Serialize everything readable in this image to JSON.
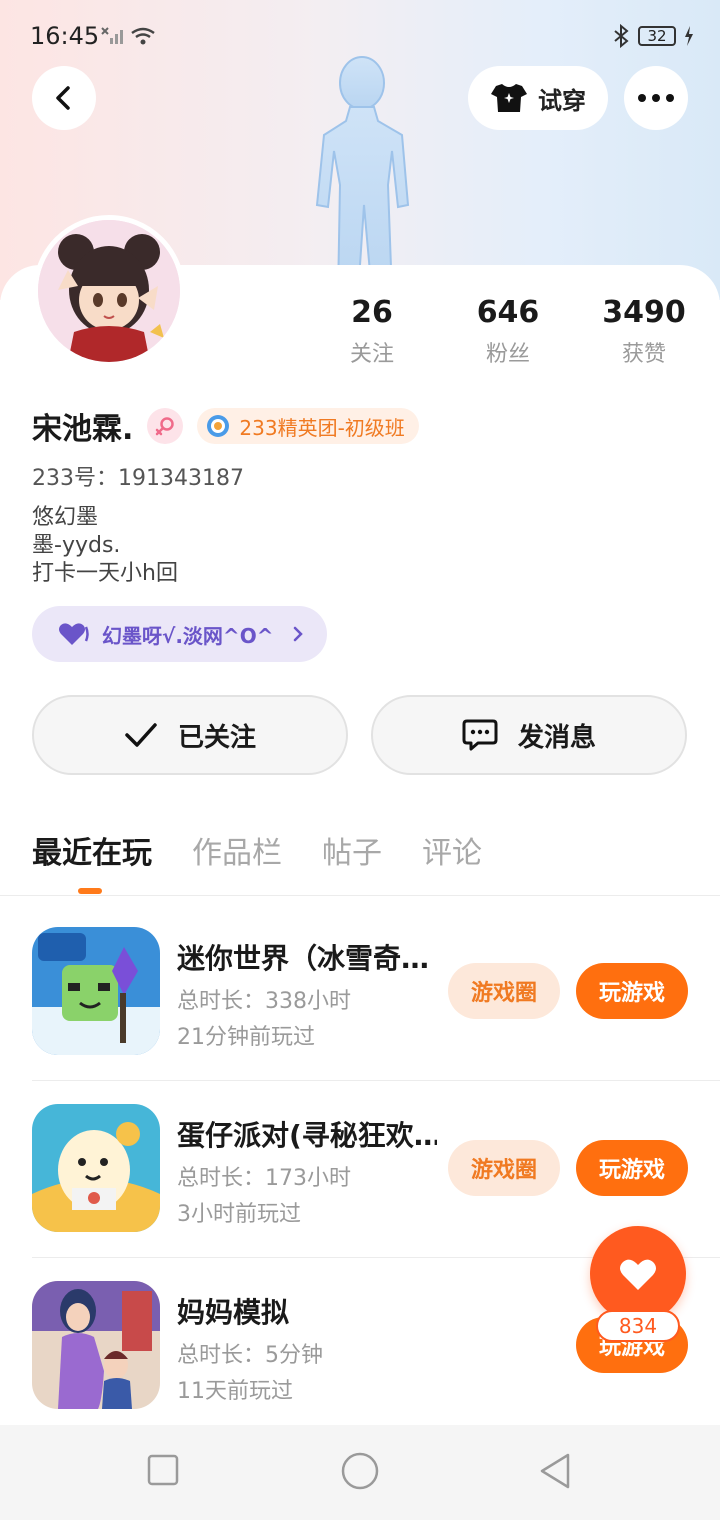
{
  "status_bar": {
    "time": "16:45",
    "battery": "32"
  },
  "header": {
    "tryon_label": "试穿"
  },
  "profile": {
    "name": "宋池霖.",
    "badge": "233精英团-初级班",
    "uid": "233号：191343187",
    "bio": [
      "悠幻墨",
      "墨-yyds.",
      "打卡一天小h回"
    ],
    "tag": "幻墨呀√.淡网^O^"
  },
  "stats": [
    {
      "value": "26",
      "label": "关注"
    },
    {
      "value": "646",
      "label": "粉丝"
    },
    {
      "value": "3490",
      "label": "获赞"
    }
  ],
  "actions": {
    "follow_label": "已关注",
    "message_label": "发消息"
  },
  "tabs": [
    "最近在玩",
    "作品栏",
    "帖子",
    "评论"
  ],
  "games": [
    {
      "title": "迷你世界（冰雪奇…",
      "duration": "总时长：338小时",
      "last_played": "21分钟前玩过",
      "circle_label": "游戏圈",
      "play_label": "玩游戏"
    },
    {
      "title": "蛋仔派对(寻秘狂欢…",
      "duration": "总时长：173小时",
      "last_played": "3小时前玩过",
      "circle_label": "游戏圈",
      "play_label": "玩游戏"
    },
    {
      "title": "妈妈模拟",
      "duration": "总时长：5分钟",
      "last_played": "11天前玩过",
      "play_label": "玩游戏"
    }
  ],
  "fab": {
    "count": "834"
  },
  "colors": {
    "accent": "#ff6f0f",
    "badge_text": "#f07a22",
    "tag_text": "#6a55c9"
  }
}
